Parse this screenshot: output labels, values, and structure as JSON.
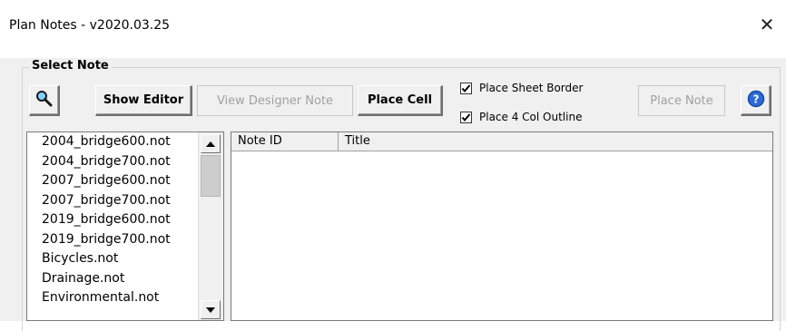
{
  "window": {
    "title": "Plan Notes - v2020.03.25",
    "close_glyph": "✕"
  },
  "group": {
    "label": "Select Note"
  },
  "toolbar": {
    "search_icon": "magnifier-icon",
    "show_editor_label": "Show Editor",
    "view_designer_label": "View Designer Note",
    "place_cell_label": "Place Cell",
    "place_note_label": "Place Note",
    "help_icon": "help-icon"
  },
  "options": {
    "place_sheet_border": {
      "label": "Place Sheet Border",
      "checked": true
    },
    "place_4_col_outline": {
      "label": "Place 4 Col Outline",
      "checked": true
    }
  },
  "file_list": {
    "items": [
      "2004_bridge600.not",
      "2004_bridge700.not",
      "2007_bridge600.not",
      "2007_bridge700.not",
      "2019_bridge600.not",
      "2019_bridge700.not",
      "Bicycles.not",
      "Drainage.not",
      "Environmental.not"
    ]
  },
  "notes_grid": {
    "columns": [
      "Note ID",
      "Title"
    ],
    "rows": []
  },
  "colors": {
    "window_bg": "#ffffff",
    "client_bg": "#f0f0f0",
    "disabled_text": "#a0a0a0",
    "help_blue": "#2a6ad8"
  }
}
